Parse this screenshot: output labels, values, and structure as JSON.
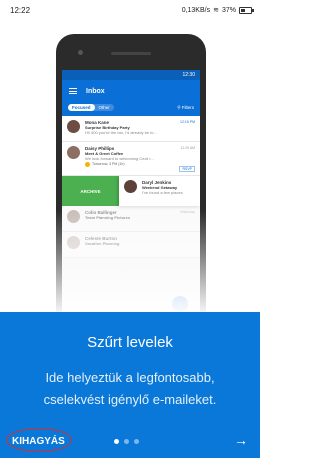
{
  "status_bar": {
    "time": "12:22",
    "network": "0,13KB/s",
    "battery": "37%"
  },
  "phone": {
    "status_time": "12:30",
    "app_title": "Inbox",
    "tabs": {
      "focused": "Focused",
      "other": "Other"
    },
    "filters": "Filters",
    "emails": [
      {
        "sender": "Mona Kane",
        "subject": "Surprise Birthday Party",
        "preview": "Hi! 400 you're the fan, I'd already be to...",
        "time": "12:15 PM",
        "avatar_color": "#6d4c41"
      },
      {
        "sender": "Daisy Phillips",
        "subject": "Meet & Greet Coffee",
        "preview": "We look forward to welcoming Cecil t...",
        "time": "11:29 AM",
        "event": "Tomorrow, 3 PM (1h)",
        "rsvp": "RSVP",
        "avatar_color": "#8d6e63"
      },
      {
        "sender": "Daryl Jenkins",
        "subject": "Weekend Getaway",
        "preview": "I've found a few places",
        "avatar_color": "#5d4037"
      },
      {
        "sender": "Colin Ballinger",
        "subject": "Team Planning Pictures",
        "time": "Yesterday",
        "avatar_color": "#a1887f"
      },
      {
        "sender": "Celeste Burton",
        "subject": "Vacation Planning",
        "avatar_color": "#bcaaa4"
      }
    ],
    "archive_label": "ARCHIVE"
  },
  "panel": {
    "title": "Szűrt levelek",
    "description": "Ide helyeztük a legfontosabb, cselekvést igénylő e-maileket.",
    "skip_label": "KIHAGYÁS",
    "next_icon": "→",
    "page_dots": 3,
    "active_dot": 1,
    "background": "#0a78d8"
  }
}
